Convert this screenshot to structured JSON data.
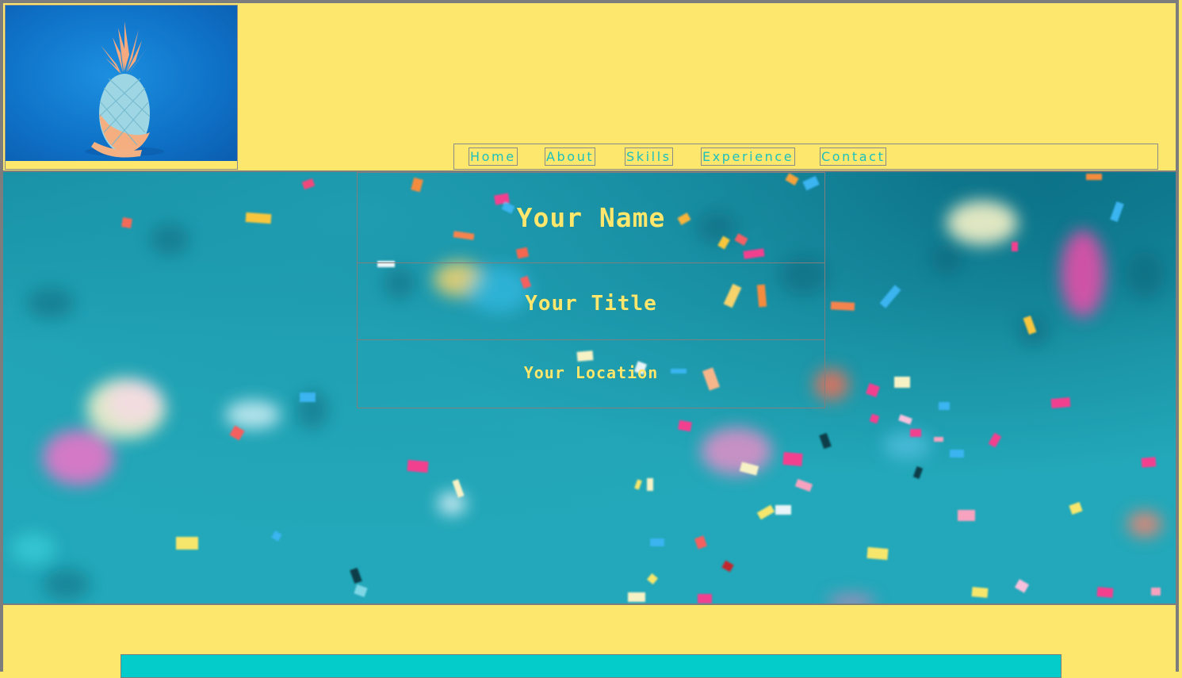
{
  "header": {
    "logo_alt": "pineapple-photo"
  },
  "nav": {
    "items": [
      {
        "label": "Home"
      },
      {
        "label": "About"
      },
      {
        "label": "Skills"
      },
      {
        "label": "Experience"
      },
      {
        "label": "Contact"
      }
    ]
  },
  "hero": {
    "name": "Your Name",
    "title": "Your Title",
    "location": "Your Location"
  },
  "colors": {
    "page_background": "#fde76d",
    "accent_text": "#fde76d",
    "nav_text": "#1bbfbf",
    "teal_bar": "#03cccb",
    "border_gray": "#7d7d7d"
  }
}
